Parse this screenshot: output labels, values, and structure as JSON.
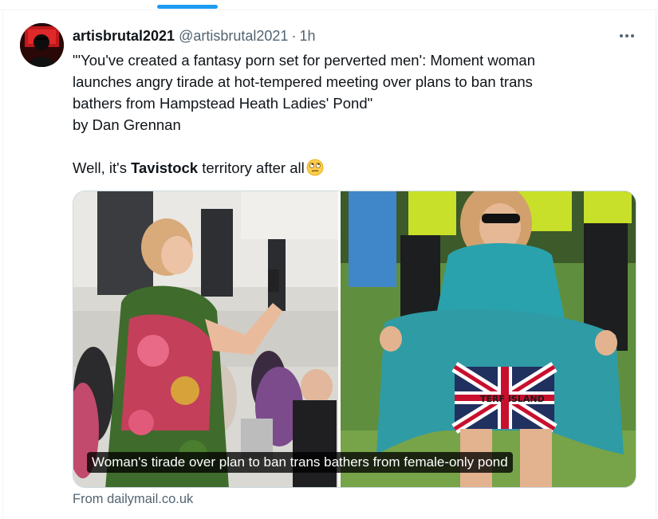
{
  "tweet": {
    "display_name": "artisbrutal2021",
    "handle": "@artisbrutal2021",
    "separator": "·",
    "time": "1h",
    "text_lines": [
      "\"'You've created a fantasy porn set for perverted  men': Moment woman",
      "launches angry tirade at hot-tempered meeting over  plans to ban trans",
      "bathers from Hampstead Heath Ladies' Pond\"",
      "by Dan Grennan"
    ],
    "comment_prefix": "Well, it's ",
    "comment_bold": "Tavistock",
    "comment_suffix": " territory after all",
    "emoji": "face-with-rolling-eyes-emoji"
  },
  "card": {
    "image_caption": "Woman's tirade over plan to ban trans bathers from female-only pond",
    "shirt_text": "TERF ISLAND",
    "source_label": "From dailymail.co.uk"
  },
  "icons": {
    "more": "more-options-icon",
    "avatar": "avatar-image"
  },
  "colors": {
    "accent": "#1d9bf0",
    "text": "#0f1419",
    "secondary": "#536471",
    "border": "#cfd9de"
  }
}
